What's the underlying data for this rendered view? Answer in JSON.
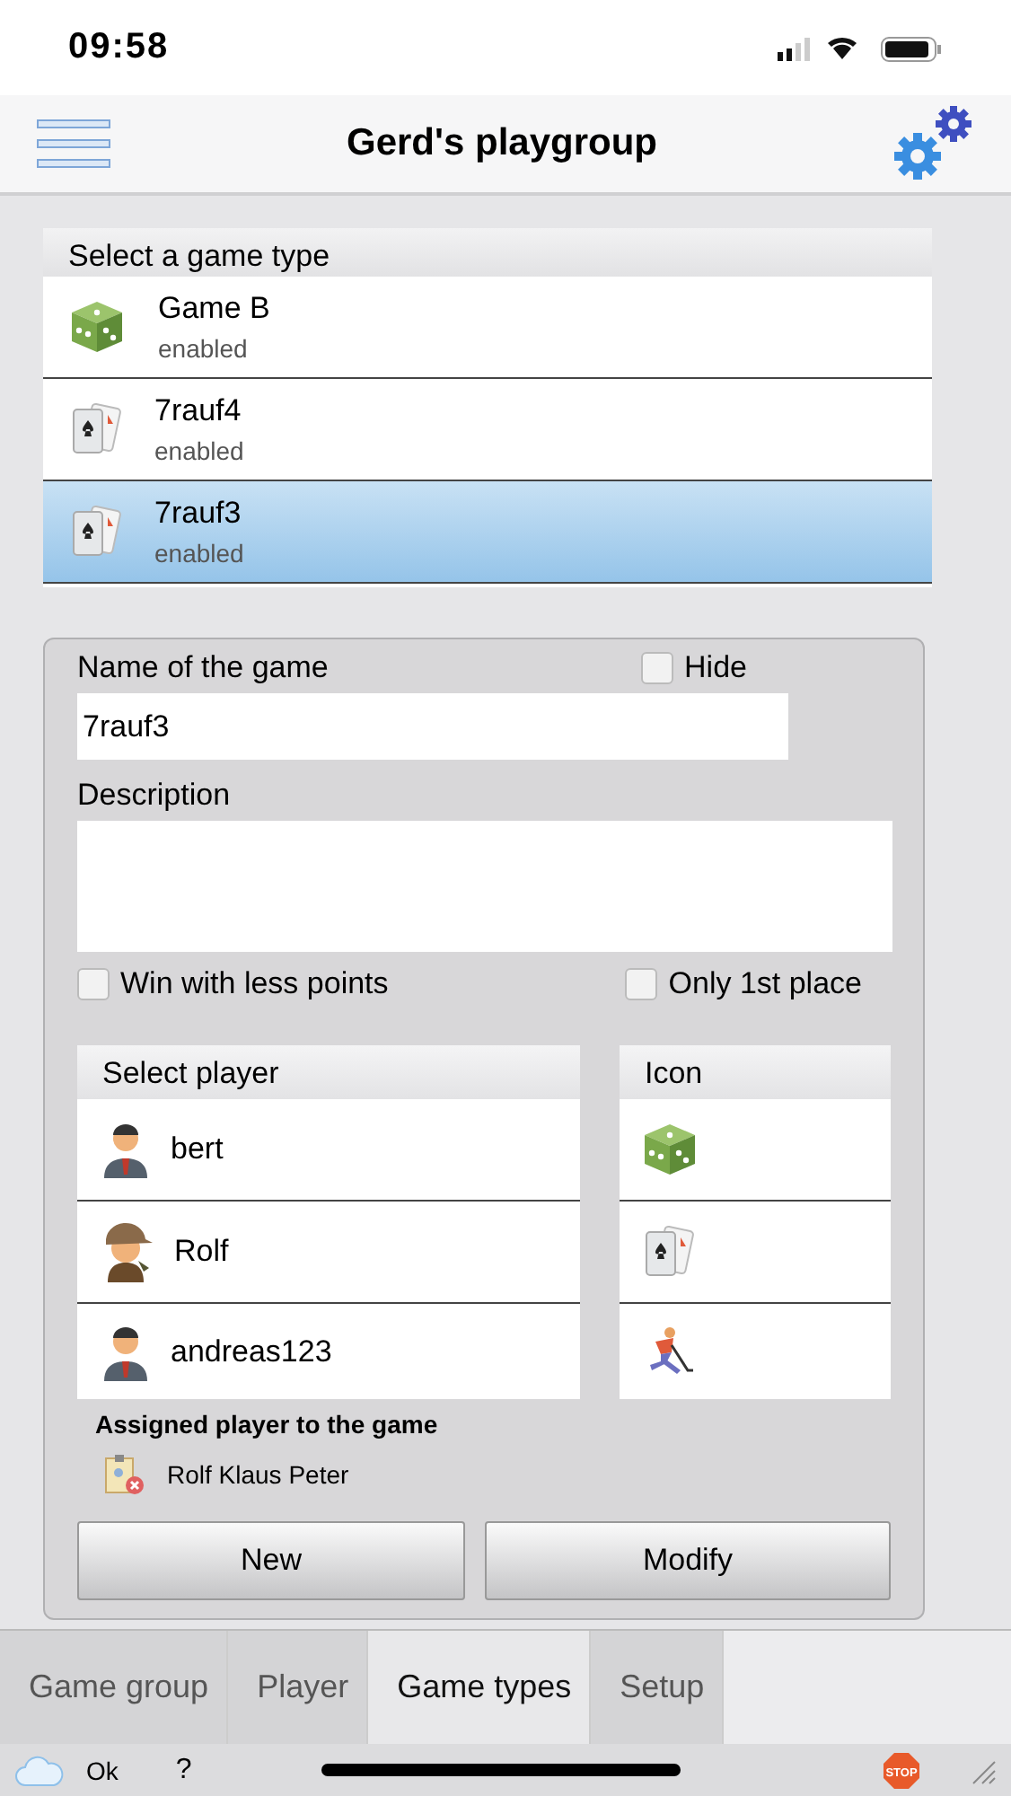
{
  "status_bar": {
    "time": "09:58"
  },
  "header": {
    "title": "Gerd's playgroup"
  },
  "game_list": {
    "title": "Select a game type",
    "items": [
      {
        "name": "Game B",
        "status": "enabled",
        "kind": "dice",
        "selected": false
      },
      {
        "name": "7rauf4",
        "status": "enabled",
        "kind": "cards",
        "selected": false
      },
      {
        "name": "7rauf3",
        "status": "enabled",
        "kind": "cards",
        "selected": true
      }
    ]
  },
  "form": {
    "name_label": "Name of the game",
    "name_value": "7rauf3",
    "hide": {
      "label": "Hide",
      "checked": false
    },
    "description_label": "Description",
    "options": [
      {
        "label": "Win with less points",
        "checked": false
      },
      {
        "label": "Only 1st place",
        "checked": false
      }
    ],
    "players": {
      "title": "Select player",
      "items": [
        {
          "name": "bert",
          "kind": "suit"
        },
        {
          "name": "Rolf",
          "kind": "hat"
        },
        {
          "name": "andreas123",
          "kind": "suit"
        }
      ]
    },
    "icons": {
      "title": "Icon",
      "items": [
        {
          "kind": "dice"
        },
        {
          "kind": "cards"
        },
        {
          "kind": "hockey"
        }
      ]
    },
    "assigned_title": "Assigned player to the game",
    "assigned_players": "Rolf Klaus Peter",
    "buttons": [
      "New",
      "Modify"
    ]
  },
  "tabs": [
    {
      "label": "Game group",
      "selected": false
    },
    {
      "label": "Player",
      "selected": false
    },
    {
      "label": "Game types",
      "selected": true
    },
    {
      "label": "Setup",
      "selected": false
    }
  ],
  "footer": {
    "status": "Ok",
    "help": "?",
    "stop_label": "STOP"
  }
}
